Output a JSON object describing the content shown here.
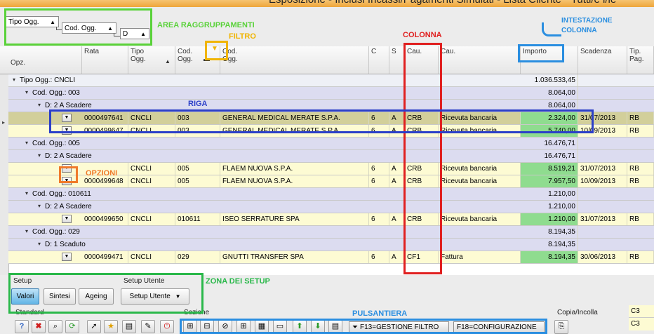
{
  "window": {
    "title": "Esposizione - Inclusi Incassi/Pagamenti Simulati - Lista Cliente * Tutti/e i/le"
  },
  "grouping": {
    "chips": [
      "Tipo Ogg.",
      "Cod. Ogg.",
      "D"
    ]
  },
  "columns": {
    "opz": "Opz.",
    "rata": "Rata",
    "tipo_ogg": [
      "Tipo",
      "Ogg."
    ],
    "cod_ogg_short": [
      "Cod.",
      "Ogg."
    ],
    "cod_ogg": [
      "Cod.",
      "Ogg."
    ],
    "c": "C",
    "s": "S",
    "cau1": "Cau.",
    "cau2": "Cau.",
    "importo": "Importo",
    "scadenza": "Scadenza",
    "tip_pag": [
      "Tip.",
      "Pag."
    ]
  },
  "rows": [
    {
      "kind": "grp1",
      "label": "Tipo Ogg.: CNCLI",
      "importo": "1.036.533,45"
    },
    {
      "kind": "grp2",
      "label": "Cod. Ogg.: 003",
      "importo": "8.064,00"
    },
    {
      "kind": "grp3",
      "label": "D: 2 A Scadere",
      "importo": "8.064,00"
    },
    {
      "kind": "sel",
      "rata": "0000497641",
      "tipo": "CNCLI",
      "cod": "003",
      "nome": "GENERAL MEDICAL MERATE S.P.A.",
      "c": "6",
      "s": "A",
      "cau": "CRB",
      "caudesc": "Ricevuta bancaria",
      "importo": "2.324,00",
      "scadenza": "31/07/2013",
      "tip": "RB"
    },
    {
      "kind": "data",
      "rata": "0000499647",
      "tipo": "CNCLI",
      "cod": "003",
      "nome": "GENERAL MEDICAL MERATE S.P.A.",
      "c": "6",
      "s": "A",
      "cau": "CRB",
      "caudesc": "Ricevuta bancaria",
      "importo": "5.740,00",
      "scadenza": "10/09/2013",
      "tip": "RB"
    },
    {
      "kind": "grp2",
      "label": "Cod. Ogg.: 005",
      "importo": "16.476,71"
    },
    {
      "kind": "grp3",
      "label": "D: 2 A Scadere",
      "importo": "16.476,71"
    },
    {
      "kind": "data",
      "rata": "",
      "tipo": "CNCLI",
      "cod": "005",
      "nome": "FLAEM NUOVA S.P.A.",
      "c": "6",
      "s": "A",
      "cau": "CRB",
      "caudesc": "Ricevuta bancaria",
      "importo": "8.519,21",
      "scadenza": "31/07/2013",
      "tip": "RB"
    },
    {
      "kind": "data",
      "rata": "0000499648",
      "tipo": "CNCLI",
      "cod": "005",
      "nome": "FLAEM NUOVA S.P.A.",
      "c": "6",
      "s": "A",
      "cau": "CRB",
      "caudesc": "Ricevuta bancaria",
      "importo": "7.957,50",
      "scadenza": "10/09/2013",
      "tip": "RB"
    },
    {
      "kind": "grp2",
      "label": "Cod. Ogg.: 010611",
      "importo": "1.210,00"
    },
    {
      "kind": "grp3",
      "label": "D: 2 A Scadere",
      "importo": "1.210,00"
    },
    {
      "kind": "data",
      "rata": "0000499650",
      "tipo": "CNCLI",
      "cod": "010611",
      "nome": "ISEO SERRATURE SPA",
      "c": "6",
      "s": "A",
      "cau": "CRB",
      "caudesc": "Ricevuta bancaria",
      "importo": "1.210,00",
      "scadenza": "31/07/2013",
      "tip": "RB"
    },
    {
      "kind": "grp2",
      "label": "Cod. Ogg.: 029",
      "importo": "8.194,35"
    },
    {
      "kind": "grp3",
      "label": "D: 1 Scaduto",
      "importo": "8.194,35"
    },
    {
      "kind": "data",
      "rata": "0000499471",
      "tipo": "CNCLI",
      "cod": "029",
      "nome": "GNUTTI TRANSFER SPA",
      "c": "6",
      "s": "A",
      "cau": "CF1",
      "caudesc": "Fattura",
      "importo": "8.194,35",
      "scadenza": "30/06/2013",
      "tip": "RB"
    }
  ],
  "annotations": {
    "area_raggruppamenti": "AREA RAGGRUPPAMENTI",
    "filtro": "FILTRO",
    "colonna": "COLONNA",
    "intestazione": [
      "INTESTAZIONE",
      "COLONNA"
    ],
    "riga": "RIGA",
    "opzioni": "OPZIONI",
    "zona_setup": "ZONA DEI SETUP",
    "pulsantiera": "PULSANTIERA"
  },
  "setup": {
    "label": "Setup",
    "buttons": [
      "Valori",
      "Sintesi",
      "Ageing"
    ],
    "utente_label": "Setup Utente",
    "utente_button": "Setup Utente"
  },
  "bottom": {
    "standard": "Standard",
    "sezione": "Sezione",
    "copia": "Copia/Incolla",
    "f13": "F13=GESTIONE FILTRO",
    "f18": "F18=CONFIGURAZIONE",
    "right_col": [
      "C3",
      "C3"
    ]
  },
  "colors": {
    "green": "#5ad23a",
    "red": "#e02020",
    "blue": "#2b3fc8",
    "orange": "#f07a2a",
    "cyan": "#2a8ee0",
    "yellow": "#f0b400"
  }
}
